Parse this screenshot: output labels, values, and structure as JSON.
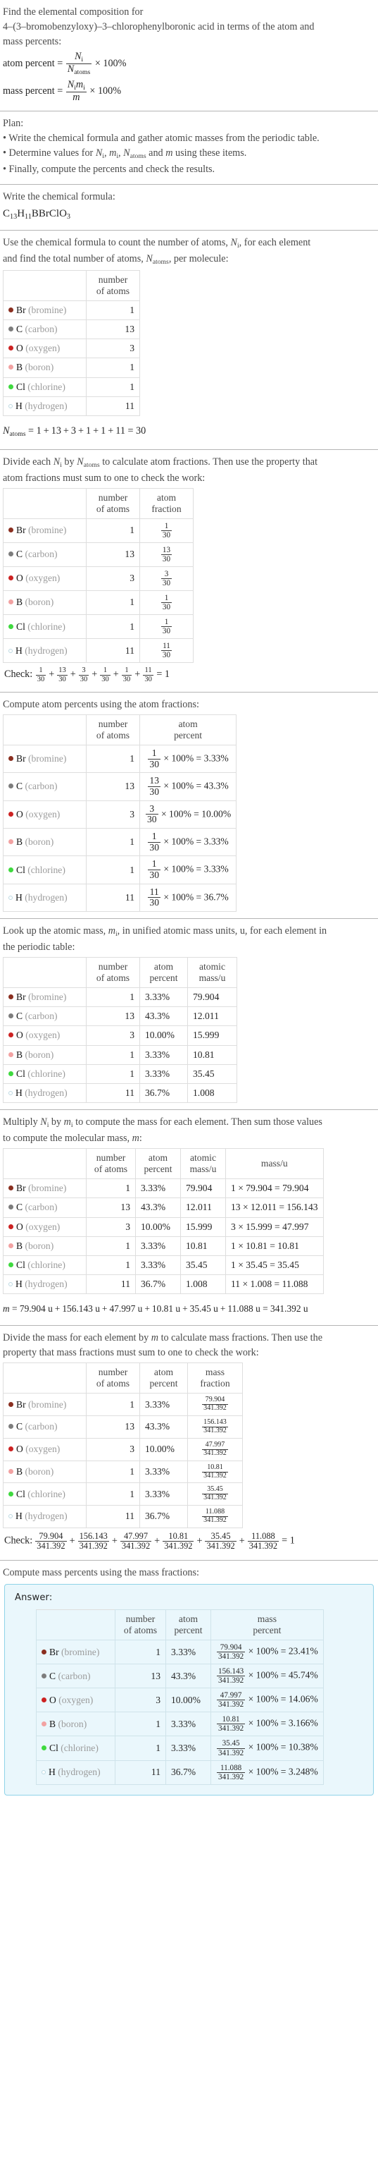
{
  "intro": {
    "line1": "Find the elemental composition for",
    "line2": "4–(3–bromobenzyloxy)–3–chlorophenylboronic acid in terms of the atom and",
    "line3": "mass percents:",
    "atom_percent_label": "atom percent =",
    "mass_percent_label": "mass percent =",
    "times100": "× 100%"
  },
  "plan": {
    "heading": "Plan:",
    "bullets": [
      "• Write the chemical formula and gather atomic masses from the periodic table.",
      "• Determine values for Ni, mi, Natoms and m using these items.",
      "• Finally, compute the percents and check the results."
    ],
    "bullet2_parts": {
      "a": "• Determine values for ",
      "b": ", ",
      "c": ", ",
      "d": " and ",
      "e": " using these items."
    }
  },
  "formula_section": {
    "heading": "Write the chemical formula:",
    "formula_parts": [
      {
        "sym": "C",
        "sub": "13"
      },
      {
        "sym": "H",
        "sub": "11"
      },
      {
        "sym": "B",
        "sub": ""
      },
      {
        "sym": "Br",
        "sub": ""
      },
      {
        "sym": "Cl",
        "sub": ""
      },
      {
        "sym": "O",
        "sub": "3"
      }
    ],
    "formula_plain": "C13H11BBrClO3"
  },
  "count_section": {
    "text_line1": "Use the chemical formula to count the number of atoms, Ni, for each element",
    "text_line2": "and find the total number of atoms, Natoms, per molecule:",
    "natoms_equation": "Natoms = 1 + 13 + 3 + 1 + 1 + 11 = 30",
    "natoms_terms": [
      "1",
      "13",
      "3",
      "1",
      "1",
      "11"
    ],
    "natoms_total": "30"
  },
  "fraction_section": {
    "text_line1": "Divide each Ni by Natoms to calculate atom fractions. Then use the property that",
    "text_line2": "atom fractions must sum to one to check the work:",
    "check_label": "Check:",
    "check_result": "1"
  },
  "atom_percent_section": {
    "heading": "Compute atom percents using the atom fractions:"
  },
  "atomic_mass_section": {
    "text_line1": "Look up the atomic mass, mi, in unified atomic mass units, u, for each element in",
    "text_line2": "the periodic table:"
  },
  "mass_section": {
    "text_line1": "Multiply Ni by mi to compute the mass for each element. Then sum those values",
    "text_line2": "to compute the molecular mass, m:",
    "m_equation_prefix": "m = ",
    "m_terms": [
      "79.904 u",
      "156.143 u",
      "47.997 u",
      "10.81 u",
      "35.45 u",
      "11.088 u"
    ],
    "m_total": "341.392 u"
  },
  "mass_fraction_section": {
    "text_line1": "Divide the mass for each element by m to calculate mass fractions. Then use the",
    "text_line2": "property that mass fractions must sum to one to check the work:",
    "check_label": "Check:",
    "check_result": "1"
  },
  "mass_percent_section": {
    "heading": "Compute mass percents using the mass fractions:",
    "answer_label": "Answer:"
  },
  "headers": {
    "blank": "",
    "number_of_atoms_l1": "number",
    "number_of_atoms_l2": "of atoms",
    "atom_fraction_l1": "atom",
    "atom_fraction_l2": "fraction",
    "atom_percent_l1": "atom",
    "atom_percent_l2": "percent",
    "atomic_mass_l1": "atomic",
    "atomic_mass_l2": "mass/u",
    "mass_per_u": "mass/u",
    "mass_fraction_l1": "mass",
    "mass_fraction_l2": "fraction",
    "mass_percent_l1": "mass",
    "mass_percent_l2": "percent"
  },
  "total_atoms": "30",
  "molecular_mass": "341.392",
  "colors": {
    "bromine": "#8a2f20",
    "carbon": "#7d7d7d",
    "oxygen": "#cc2222",
    "boron": "#f2a2a2",
    "chlorine": "#3fd93f",
    "hydrogen": "#ffffff",
    "hydrogen_border": "#bcd9e2",
    "answer_bg": "#eaf7fc",
    "answer_border": "#8fd3e8",
    "rule": "#b5b5b5",
    "table_border": "#dedede"
  },
  "elements": [
    {
      "symbol": "Br",
      "name": "(bromine)",
      "color": "#8a2f20",
      "hollow": false,
      "count": "1",
      "atom_fraction_num": "1",
      "atom_fraction_den": "30",
      "atom_percent": "3.33%",
      "atomic_mass": "79.904",
      "mass_product": "1 × 79.904 = 79.904",
      "mass_value": "79.904",
      "mass_fraction_num": "79.904",
      "mass_fraction_den": "341.392",
      "mass_percent": "23.41%"
    },
    {
      "symbol": "C",
      "name": "(carbon)",
      "color": "#7d7d7d",
      "hollow": false,
      "count": "13",
      "atom_fraction_num": "13",
      "atom_fraction_den": "30",
      "atom_percent": "43.3%",
      "atomic_mass": "12.011",
      "mass_product": "13 × 12.011 = 156.143",
      "mass_value": "156.143",
      "mass_fraction_num": "156.143",
      "mass_fraction_den": "341.392",
      "mass_percent": "45.74%"
    },
    {
      "symbol": "O",
      "name": "(oxygen)",
      "color": "#cc2222",
      "hollow": false,
      "count": "3",
      "atom_fraction_num": "3",
      "atom_fraction_den": "30",
      "atom_percent": "10.00%",
      "atomic_mass": "15.999",
      "mass_product": "3 × 15.999 = 47.997",
      "mass_value": "47.997",
      "mass_fraction_num": "47.997",
      "mass_fraction_den": "341.392",
      "mass_percent": "14.06%"
    },
    {
      "symbol": "B",
      "name": "(boron)",
      "color": "#f2a2a2",
      "hollow": false,
      "count": "1",
      "atom_fraction_num": "1",
      "atom_fraction_den": "30",
      "atom_percent": "3.33%",
      "atomic_mass": "10.81",
      "mass_product": "1 × 10.81 = 10.81",
      "mass_value": "10.81",
      "mass_fraction_num": "10.81",
      "mass_fraction_den": "341.392",
      "mass_percent": "3.166%"
    },
    {
      "symbol": "Cl",
      "name": "(chlorine)",
      "color": "#3fd93f",
      "hollow": false,
      "count": "1",
      "atom_fraction_num": "1",
      "atom_fraction_den": "30",
      "atom_percent": "3.33%",
      "atomic_mass": "35.45",
      "mass_product": "1 × 35.45 = 35.45",
      "mass_value": "35.45",
      "mass_fraction_num": "35.45",
      "mass_fraction_den": "341.392",
      "mass_percent": "10.38%"
    },
    {
      "symbol": "H",
      "name": "(hydrogen)",
      "color": "#ffffff",
      "hollow": true,
      "count": "11",
      "atom_fraction_num": "11",
      "atom_fraction_den": "30",
      "atom_percent": "36.7%",
      "atomic_mass": "1.008",
      "mass_product": "11 × 1.008 = 11.088",
      "mass_value": "11.088",
      "mass_fraction_num": "11.088",
      "mass_fraction_den": "341.392",
      "mass_percent": "3.248%"
    }
  ]
}
